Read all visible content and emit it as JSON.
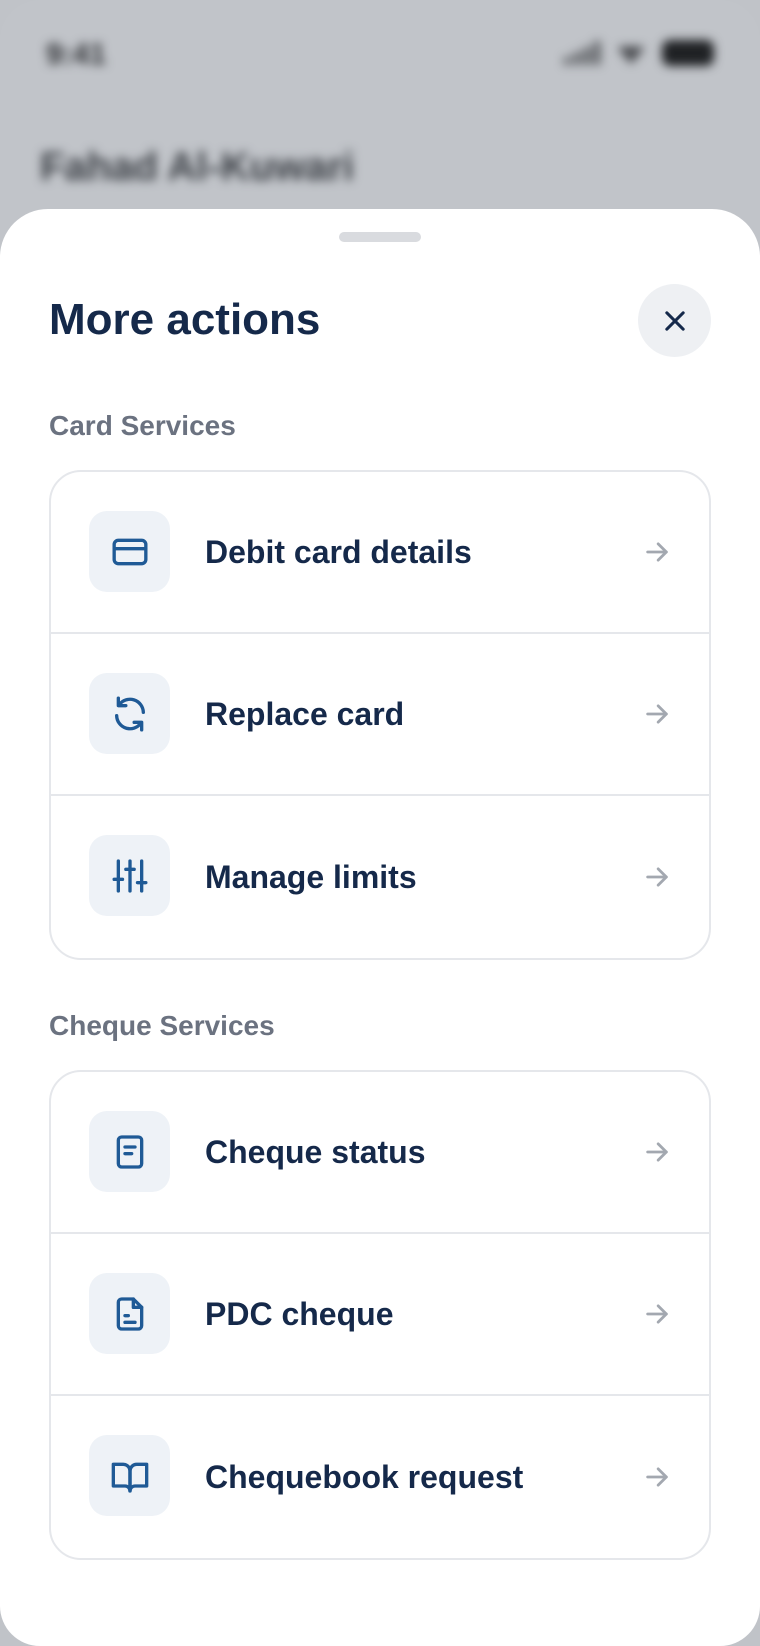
{
  "status_bar": {
    "time": "9:41"
  },
  "background": {
    "account_name": "Fahad Al-Kuwari"
  },
  "sheet": {
    "title": "More actions",
    "close_icon": "close-icon"
  },
  "card_services": {
    "label": "Card Services",
    "items": [
      {
        "label": "Debit card details",
        "icon": "credit-card-icon"
      },
      {
        "label": "Replace card",
        "icon": "refresh-icon"
      },
      {
        "label": "Manage limits",
        "icon": "sliders-icon"
      }
    ]
  },
  "cheque_services": {
    "label": "Cheque Services",
    "items": [
      {
        "label": "Cheque status",
        "icon": "document-icon"
      },
      {
        "label": "PDC cheque",
        "icon": "file-text-icon"
      },
      {
        "label": "Chequebook request",
        "icon": "book-open-icon"
      }
    ]
  },
  "colors": {
    "primary_text": "#15294a",
    "icon_blue": "#1f5a96",
    "section_label": "#6b7280",
    "arrow": "#a3a8b0",
    "icon_tile_bg": "#eef2f7",
    "backdrop": "#c1c4c9"
  }
}
